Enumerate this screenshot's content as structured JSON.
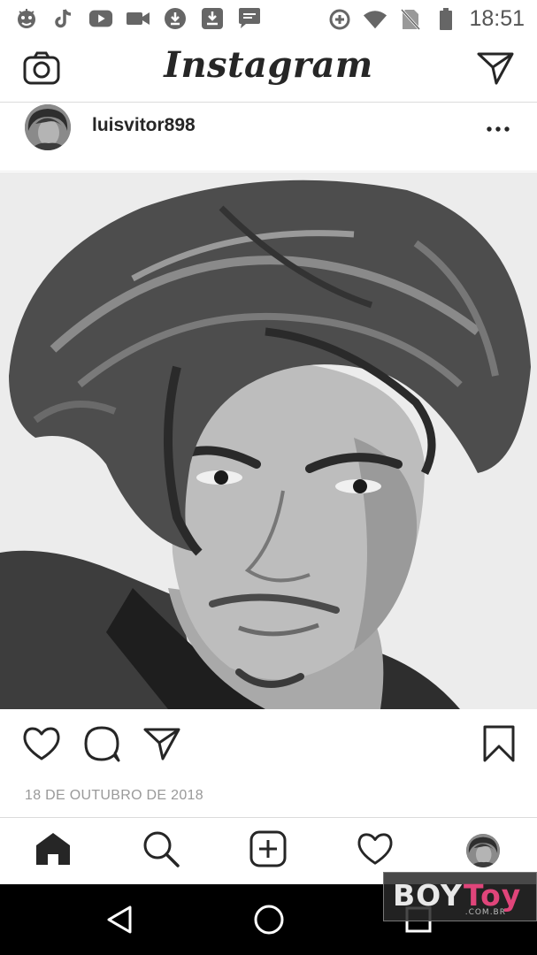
{
  "status_bar": {
    "time": "18:51",
    "left_icons": [
      "emoji-app-icon",
      "tiktok-icon",
      "youtube-icon",
      "video-camera-icon",
      "download-icon",
      "download-box-icon",
      "message-icon"
    ],
    "right_icons": [
      "data-saver-icon",
      "wifi-icon",
      "no-sim-icon",
      "battery-icon"
    ]
  },
  "header": {
    "logo": "Instagram",
    "left_icon": "camera-icon",
    "right_icon": "direct-message-icon"
  },
  "post": {
    "username": "luisvitor898",
    "date": "18 DE OUTUBRO DE 2018",
    "photo": "black-and-white selfie portrait"
  },
  "actions": {
    "icons": [
      "heart-icon",
      "comment-icon",
      "share-icon",
      "bookmark-icon"
    ]
  },
  "bottom_nav": {
    "icons": [
      "home-icon",
      "search-icon",
      "add-post-icon",
      "activity-heart-icon",
      "profile-avatar"
    ]
  },
  "android_nav": {
    "icons": [
      "back-triangle-icon",
      "home-circle-icon",
      "recents-square-icon"
    ]
  },
  "watermark": {
    "part1": "BOY",
    "part2": "Toy",
    "domain": ".COM.BR",
    "accent_color": "#e0457a"
  },
  "colors": {
    "text": "#262626",
    "muted": "#999999",
    "divider": "#dbdbdb"
  }
}
